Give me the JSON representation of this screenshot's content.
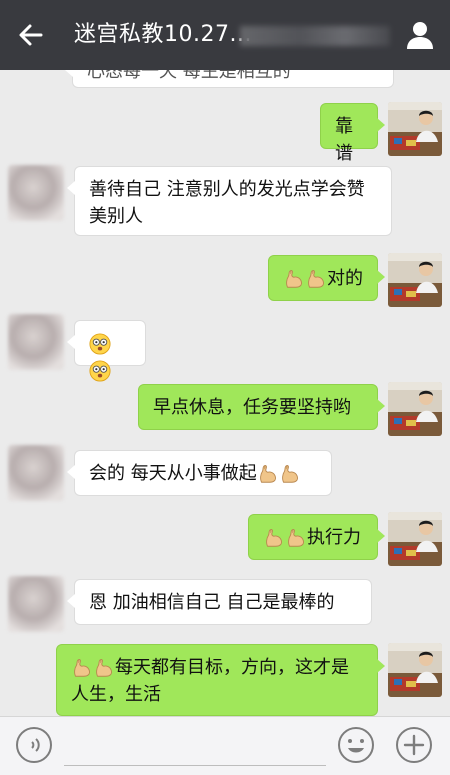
{
  "header": {
    "title": "迷宫私教10.27..."
  },
  "messages": [
    {
      "side": "left",
      "text": "心态每一天 每生是相互的",
      "partial": true
    },
    {
      "side": "right",
      "text": "靠谱"
    },
    {
      "side": "left",
      "text": "善待自己 注意别人的发光点学会赞美别人"
    },
    {
      "side": "right",
      "prefix_icons": [
        "flexed-biceps",
        "flexed-biceps"
      ],
      "text": "对的"
    },
    {
      "side": "left",
      "icons": [
        "dizzy-face",
        "dizzy-face"
      ]
    },
    {
      "side": "right",
      "text": "早点休息，任务要坚持哟"
    },
    {
      "side": "left",
      "text": "会的 每天从小事做起",
      "suffix_icons": [
        "flexed-biceps",
        "flexed-biceps"
      ]
    },
    {
      "side": "right",
      "prefix_icons": [
        "flexed-biceps",
        "flexed-biceps"
      ],
      "text": "执行力"
    },
    {
      "side": "left",
      "text": "恩 加油相信自己 自己是最棒的"
    },
    {
      "side": "right",
      "prefix_icons": [
        "flexed-biceps",
        "flexed-biceps"
      ],
      "text": "每天都有目标，方向，这才是人生，生活"
    }
  ],
  "colors": {
    "topbar": "#393a3f",
    "chat_bg": "#ebebeb",
    "right_bubble": "#a0e75a",
    "left_bubble": "#ffffff"
  }
}
